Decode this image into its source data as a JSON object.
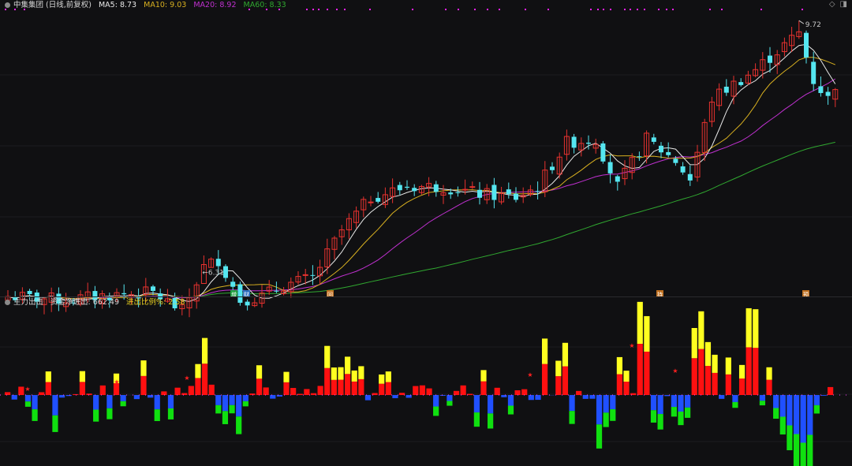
{
  "header": {
    "stock": "中集集团 (日线,前复权)",
    "ma5": "MA5: 8.73",
    "ma10": "MA10: 9.03",
    "ma20": "MA20: 8.92",
    "ma60": "MA60: 8.33"
  },
  "indicator": {
    "name": "主力出击",
    "netflow": "资金净进出: 662.49",
    "ratio": "进出比例%: 2.58"
  },
  "colors": {
    "up": "#e8322f",
    "down": "#55e6f0",
    "ma5": "#e8e8e8",
    "ma10": "#d8b020",
    "ma20": "#c030d0",
    "ma60": "#30a830",
    "barRed": "#ff1010",
    "barYellow": "#ffff20",
    "barBlue": "#2050ff",
    "barGreen": "#10e010",
    "magenta": "#ff20ff"
  },
  "icons": {
    "diamond": "diamond-icon",
    "panel": "panel-icon"
  },
  "chart_data": [
    {
      "type": "candlestick",
      "annotations": [
        {
          "text": "9.72",
          "index": 109
        },
        {
          "text": "6.31",
          "index": 27
        }
      ],
      "markers": [
        "增",
        "财",
        "回",
        "持",
        "预"
      ]
    },
    {
      "type": "bar",
      "title": "主力出击"
    }
  ]
}
